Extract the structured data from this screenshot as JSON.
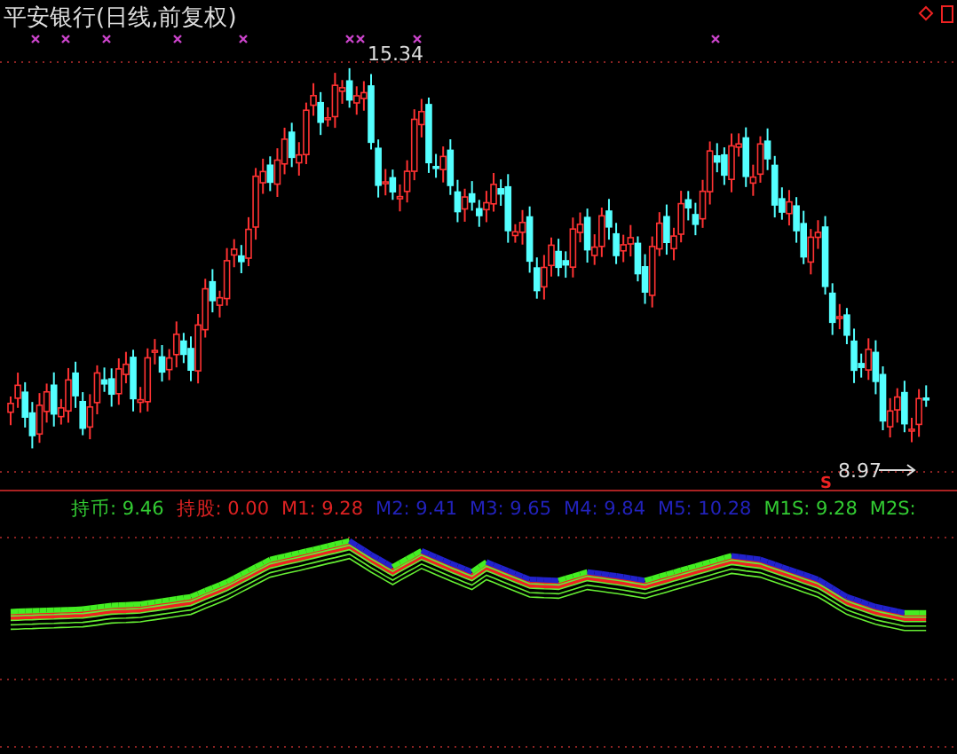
{
  "chart_title": "平安银行(日线,前复权)",
  "price_chart": {
    "high_label": "15.34",
    "low_label": "8.97",
    "signal_label": "S"
  },
  "indicator_legend": [
    {
      "label": "持币:",
      "value": "9.46",
      "color": "#33cc33"
    },
    {
      "label": "持股:",
      "value": "0.00",
      "color": "#dd2222"
    },
    {
      "label": "M1:",
      "value": "9.28",
      "color": "#dd2222"
    },
    {
      "label": "M2:",
      "value": "9.41",
      "color": "#2222bb"
    },
    {
      "label": "M3:",
      "value": "9.65",
      "color": "#2222bb"
    },
    {
      "label": "M4:",
      "value": "9.84",
      "color": "#2222bb"
    },
    {
      "label": "M5:",
      "value": "10.28",
      "color": "#2222bb"
    },
    {
      "label": "M1S:",
      "value": "9.28",
      "color": "#33cc33"
    },
    {
      "label": "M2S:",
      "color": "#33cc33"
    }
  ]
}
